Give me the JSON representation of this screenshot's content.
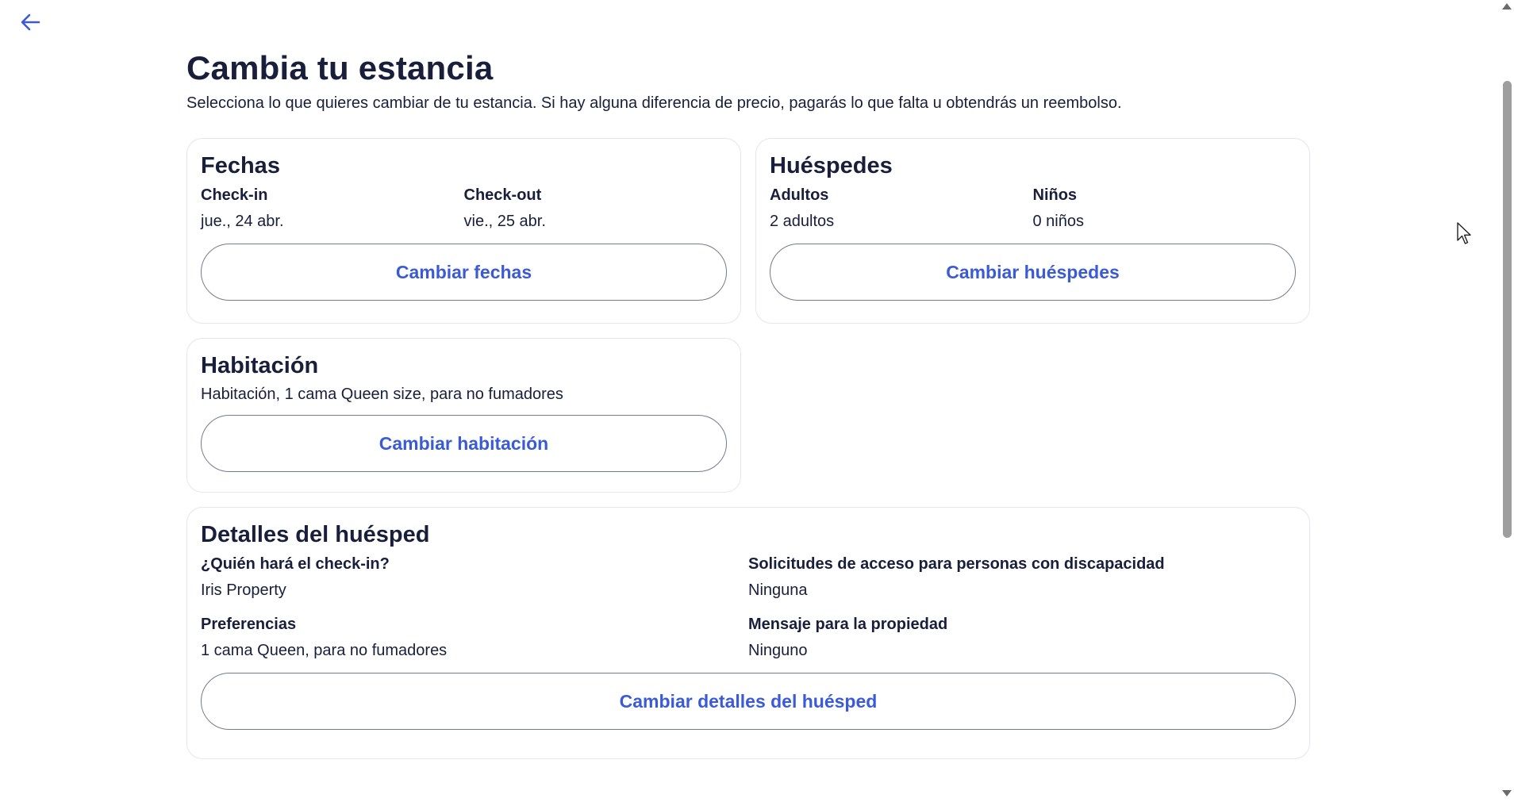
{
  "header": {
    "back_label": "Volver",
    "title": "Cambia tu estancia",
    "subtitle": "Selecciona lo que quieres cambiar de tu estancia. Si hay alguna diferencia de precio, pagarás lo que falta u obtendrás un reembolso."
  },
  "dates": {
    "title": "Fechas",
    "checkin_label": "Check-in",
    "checkin_value": "jue., 24 abr.",
    "checkout_label": "Check-out",
    "checkout_value": "vie., 25 abr.",
    "button": "Cambiar fechas"
  },
  "guests": {
    "title": "Huéspedes",
    "adults_label": "Adultos",
    "adults_value": "2 adultos",
    "children_label": "Niños",
    "children_value": "0 niños",
    "button": "Cambiar huéspedes"
  },
  "room": {
    "title": "Habitación",
    "description": "Habitación, 1 cama Queen size, para no fumadores",
    "button": "Cambiar habitación"
  },
  "guest_details": {
    "title": "Detalles del huésped",
    "checkin_person_label": "¿Quién hará el check-in?",
    "checkin_person_value": "Iris Property",
    "accessibility_label": "Solicitudes de acceso para personas con discapacidad",
    "accessibility_value": "Ninguna",
    "preferences_label": "Preferencias",
    "preferences_value": "1 cama Queen, para no fumadores",
    "message_label": "Mensaje para la propiedad",
    "message_value": "Ninguno",
    "button": "Cambiar detalles del huésped"
  },
  "colors": {
    "text": "#191e3b",
    "accent": "#3b5bd6",
    "border": "#e4e6ec",
    "button_border": "#767a8f"
  },
  "icons": {
    "back": "arrow-left-icon",
    "cursor": "mouse-pointer-icon"
  }
}
